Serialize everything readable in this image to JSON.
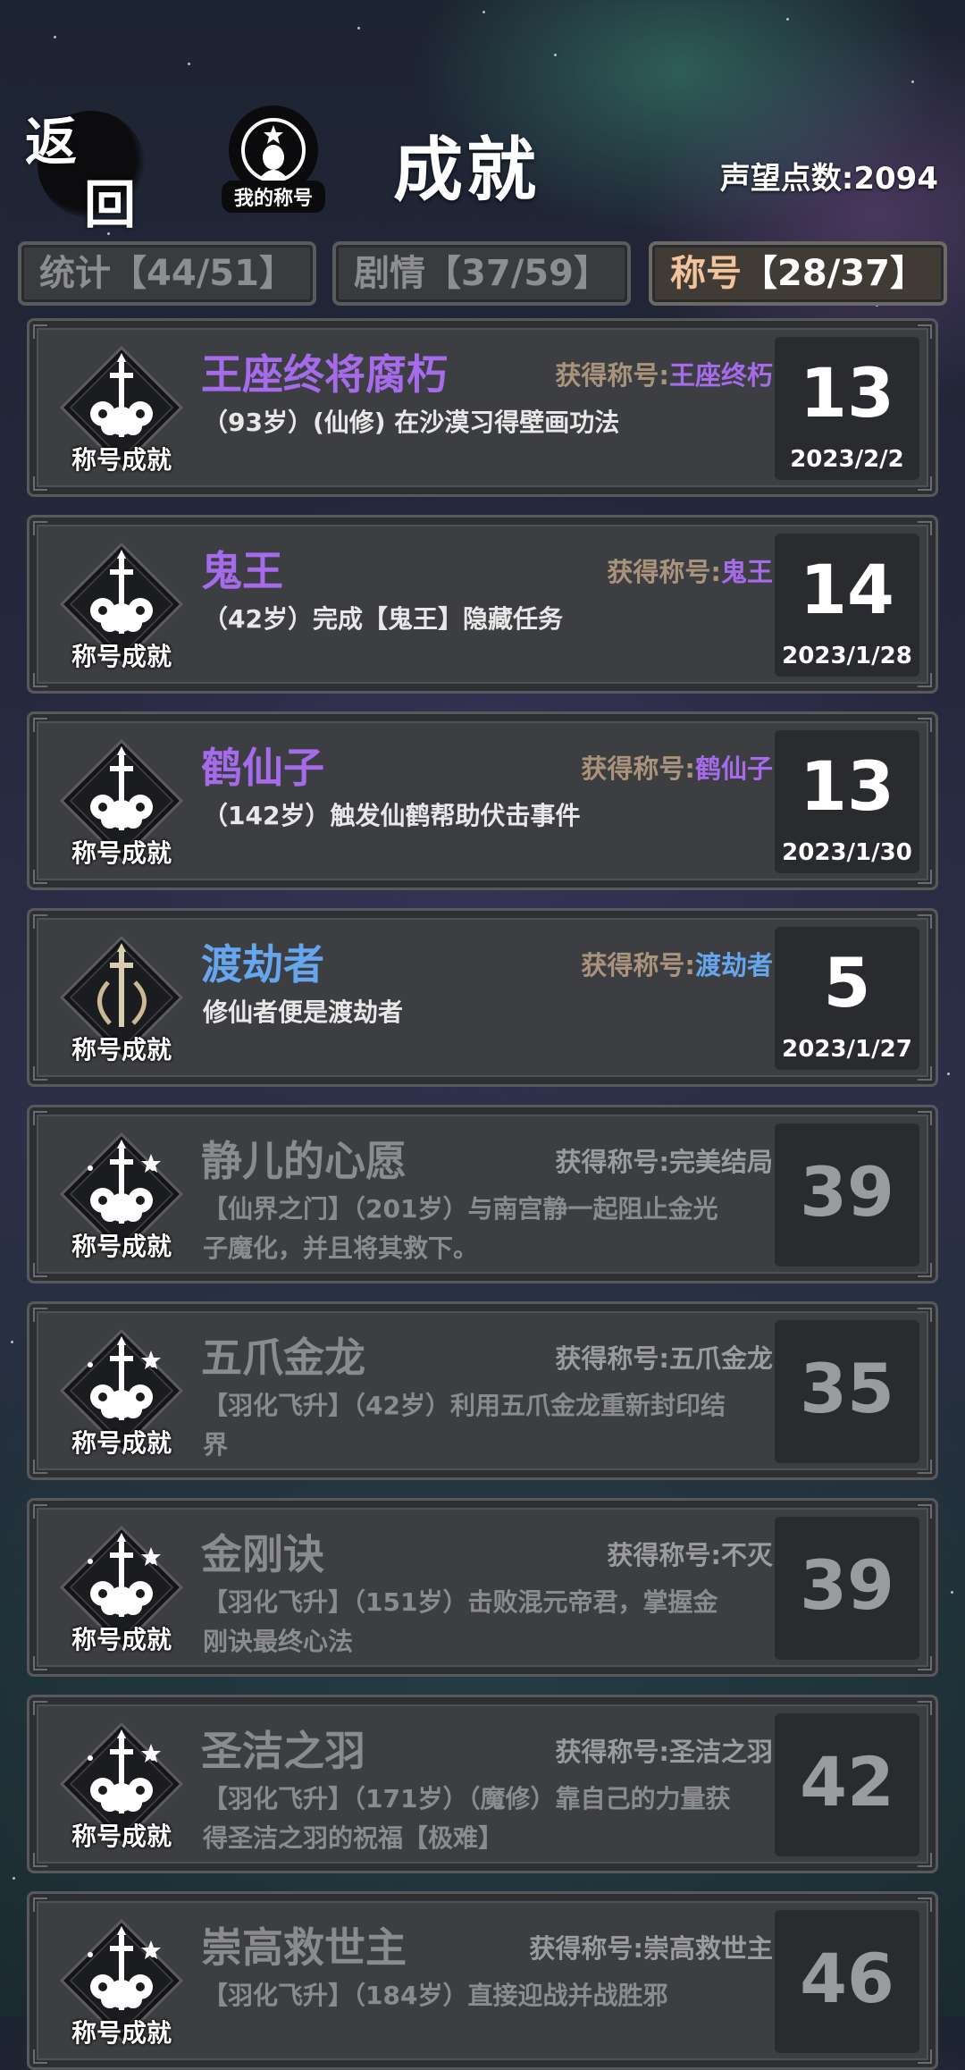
{
  "header": {
    "back_top": "返",
    "back_bottom": "回",
    "my_title_label": "我的称号",
    "page_title": "成就",
    "reputation": "声望点数:2094"
  },
  "tabs": [
    {
      "label": "统计",
      "count": "【44/51】",
      "active": false
    },
    {
      "label": "剧情",
      "count": "【37/59】",
      "active": false
    },
    {
      "label": "称号",
      "count": "【28/37】",
      "active": true
    }
  ],
  "badge_label": "称号成就",
  "reward_prefix": "获得称号:",
  "colors": {
    "purple": "#a56bea",
    "blue": "#66a6ee",
    "locked": "#8a8b8e",
    "tab_active": "#f3c49b"
  },
  "achievements": [
    {
      "title": "王座终将腐朽",
      "reward": "王座终朽",
      "desc": "（93岁）(仙修) 在沙漠习得壁画功法",
      "score": "13",
      "date": "2023/2/2",
      "color": "#a56bea",
      "locked": false,
      "icon": "sword-cloud-icon"
    },
    {
      "title": "鬼王",
      "reward": "鬼王",
      "desc": "（42岁）完成【鬼王】隐藏任务",
      "score": "14",
      "date": "2023/1/28",
      "color": "#a56bea",
      "locked": false,
      "icon": "sword-cloud-icon"
    },
    {
      "title": "鹤仙子",
      "reward": "鹤仙子",
      "desc": "（142岁）触发仙鹤帮助伏击事件",
      "score": "13",
      "date": "2023/1/30",
      "color": "#a56bea",
      "locked": false,
      "icon": "sword-cloud-icon"
    },
    {
      "title": "渡劫者",
      "reward": "渡劫者",
      "desc": "修仙者便是渡劫者",
      "score": "5",
      "date": "2023/1/27",
      "color": "#66a6ee",
      "locked": false,
      "icon": "sword-gold-icon"
    },
    {
      "title": "静儿的心愿",
      "reward": "完美结局",
      "desc": "【仙界之门】（201岁）与南宫静一起阻止金光子魔化，并且将其救下。",
      "score": "39",
      "date": "",
      "color": "#8a8b8e",
      "locked": true,
      "icon": "sword-cloud-ornate-icon"
    },
    {
      "title": "五爪金龙",
      "reward": "五爪金龙",
      "desc": "【羽化飞升】（42岁）利用五爪金龙重新封印结界",
      "score": "35",
      "date": "",
      "color": "#8a8b8e",
      "locked": true,
      "icon": "sword-cloud-ornate-icon"
    },
    {
      "title": "金刚诀",
      "reward": "不灭",
      "desc": "【羽化飞升】（151岁）击败混元帝君，掌握金刚诀最终心法",
      "score": "39",
      "date": "",
      "color": "#8a8b8e",
      "locked": true,
      "icon": "sword-cloud-ornate-icon"
    },
    {
      "title": "圣洁之羽",
      "reward": "圣洁之羽",
      "desc": "【羽化飞升】（171岁）（魔修）靠自己的力量获得圣洁之羽的祝福【极难】",
      "score": "42",
      "date": "",
      "color": "#8a8b8e",
      "locked": true,
      "icon": "sword-cloud-ornate-icon"
    },
    {
      "title": "崇高救世主",
      "reward": "崇高救世主",
      "desc": "【羽化飞升】（184岁）直接迎战并战胜邪",
      "score": "46",
      "date": "",
      "color": "#8a8b8e",
      "locked": true,
      "icon": "sword-cloud-ornate-icon"
    }
  ]
}
